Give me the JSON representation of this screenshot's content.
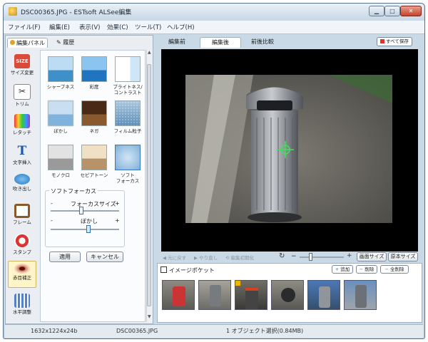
{
  "window": {
    "title": "DSC00365.JPG - ESTsoft ALSee編集",
    "controls": [
      "▁",
      "□",
      "✕"
    ]
  },
  "menu": [
    "ファイル(F)",
    "編集(E)",
    "表示(V)",
    "効果(C)",
    "ツール(T)",
    "ヘルプ(H)"
  ],
  "left_tabs": {
    "edit_panel": "編集パネル",
    "history": "履歴"
  },
  "tools": [
    {
      "label": "サイズ変更",
      "icon": "size-icon"
    },
    {
      "label": "トリム",
      "icon": "scissors-icon"
    },
    {
      "label": "レタッチ",
      "icon": "color-swatch-icon"
    },
    {
      "label": "文字挿入",
      "icon": "text-t-icon"
    },
    {
      "label": "吹き出し",
      "icon": "speech-bubble-icon"
    },
    {
      "label": "フレーム",
      "icon": "frame-icon"
    },
    {
      "label": "スタンプ",
      "icon": "stamp-icon"
    },
    {
      "label": "赤目補正",
      "icon": "eye-icon"
    },
    {
      "label": "水平調整",
      "icon": "grid-icon"
    }
  ],
  "size_badge": "SIZE",
  "effects": [
    {
      "label": "シャープネス"
    },
    {
      "label": "彩度"
    },
    {
      "label": "ブライトネス/\nコントラスト"
    },
    {
      "label": "ぼかし"
    },
    {
      "label": "ネガ"
    },
    {
      "label": "フィルム粒子"
    },
    {
      "label": "モノクロ"
    },
    {
      "label": "セピアトーン"
    },
    {
      "label": "ソフト\nフォーカス"
    }
  ],
  "soft_focus": {
    "group_title": "ソフトフォーカス",
    "focus_size_label": "フォーカスサイズ",
    "focus_size_value": 0.45,
    "blur_label": "ぼかし",
    "blur_value": 0.55,
    "minus": "-",
    "plus": "+"
  },
  "buttons": {
    "apply": "適用",
    "cancel": "キャンセル"
  },
  "right_tabs": [
    "編集前",
    "編集後",
    "前後比較"
  ],
  "save_all": "すべて保存",
  "toolbar": {
    "undo": "元に戻す",
    "redo": "やり直し",
    "reset": "編集初期化",
    "fit_screen": "画面サイズ",
    "original_size": "原本サイズ",
    "zoom_minus": "−",
    "zoom_plus": "+",
    "zoom_value": 0.25
  },
  "pocket": {
    "title": "イメージポケット",
    "add": "追加",
    "delete": "削除",
    "delete_all": "全削除",
    "thumbnails": 6
  },
  "status": {
    "dimensions": "1632x1224x24b",
    "filename": "DSC00365.JPG",
    "selection": "1 オブジェクト選択(0.84MB)"
  },
  "colors": {
    "accent_tab": "#d7e6f3",
    "selected_tool": "#fff5c8",
    "focus_crosshair": "#3fe15a"
  }
}
